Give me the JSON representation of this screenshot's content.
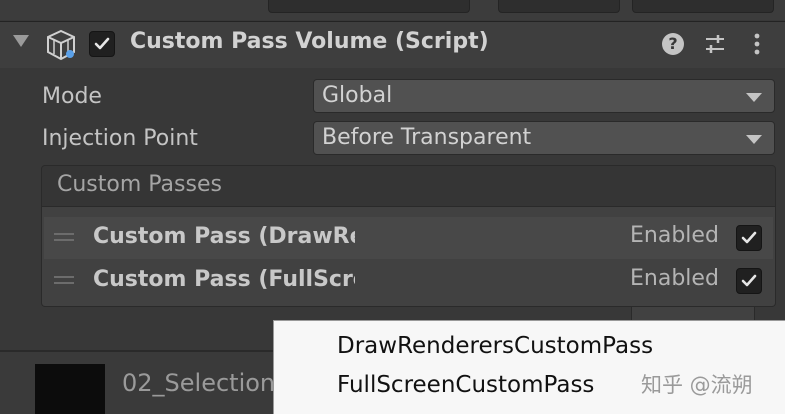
{
  "component": {
    "title": "Custom Pass Volume (Script)",
    "enabled": true,
    "help_icon": "question-circle-icon",
    "help_glyph": "?",
    "preset_icon": "sliders-preset-icon",
    "menu_icon": "vertical-dots-icon",
    "component_icon": "custom-pass-volume-cube-icon"
  },
  "properties": {
    "mode": {
      "label": "Mode",
      "value": "Global"
    },
    "injection_point": {
      "label": "Injection Point",
      "value": "Before Transparent"
    }
  },
  "custom_passes": {
    "header": "Custom Passes",
    "items": [
      {
        "name": "Custom Pass (DrawRenderersCustomPass)",
        "enabled_label": "Enabled",
        "enabled": true
      },
      {
        "name": "Custom Pass (FullScreenCustomPass)",
        "enabled_label": "Enabled",
        "enabled": true
      }
    ]
  },
  "add_menu": {
    "items": [
      "DrawRenderersCustomPass",
      "FullScreenCustomPass"
    ]
  },
  "bottom": {
    "asset_name": "02_Selection"
  },
  "watermark": "知乎 @流朔",
  "colors": {
    "background": "#383838",
    "dropdown": "#515151",
    "checkbox": "#202020",
    "popup": "#f7f7f7"
  }
}
